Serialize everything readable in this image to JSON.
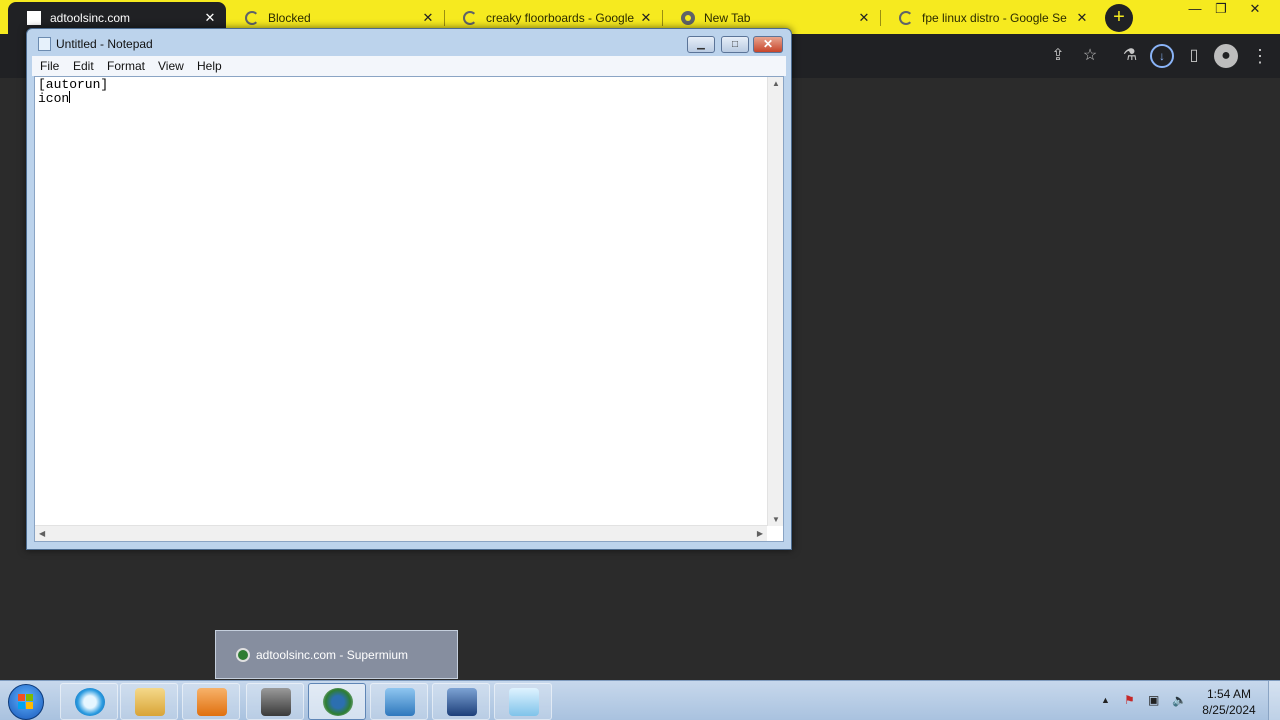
{
  "browser": {
    "tabs": [
      {
        "title": "adtoolsinc.com",
        "icon": "white-square-icon",
        "active": true
      },
      {
        "title": "Blocked",
        "icon": "google-icon",
        "active": false
      },
      {
        "title": "creaky floorboards - Google",
        "icon": "google-icon",
        "active": false
      },
      {
        "title": "New Tab",
        "icon": "chrome-icon",
        "active": false
      },
      {
        "title": "fpe linux distro - Google Se",
        "icon": "google-icon",
        "active": false
      }
    ],
    "close_glyph": "✕",
    "new_tab_glyph": "+",
    "window_controls": {
      "minimize": "—",
      "restore": "❐",
      "close": "✕"
    },
    "toolbar_icons": [
      "share-icon",
      "star-icon",
      "flask-icon",
      "download-icon",
      "sidepanel-icon",
      "profile-icon",
      "menu-icon"
    ],
    "accent_color": "#f6ea1f"
  },
  "notepad": {
    "title": "Untitled - Notepad",
    "menu": [
      "File",
      "Edit",
      "Format",
      "View",
      "Help"
    ],
    "lines": [
      "[autorun]",
      "icon"
    ],
    "controls": {
      "minimize": "▁",
      "maximize": "□",
      "close": "✕"
    }
  },
  "taskbar": {
    "thumbnail_title": "adtoolsinc.com - Supermium",
    "apps": [
      "start-orb",
      "browser-app",
      "explorer-app",
      "media-player-app",
      "photo-app",
      "supermium-app",
      "control-panel-app",
      "remote-desktop-app",
      "notepad-app"
    ],
    "tray": {
      "show_hidden": "▲"
    },
    "clock": {
      "time": "1:54 AM",
      "date": "8/25/2024"
    }
  }
}
